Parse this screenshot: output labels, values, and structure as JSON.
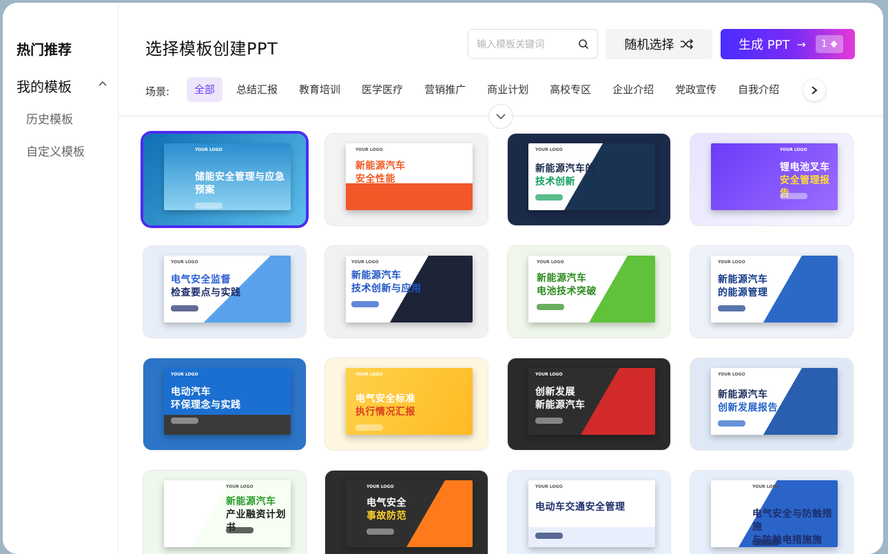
{
  "sidebar": {
    "hot": "热门推荐",
    "my_templates": "我的模板",
    "history": "历史模板",
    "custom": "自定义模板"
  },
  "header": {
    "title": "选择模板创建PPT",
    "search_placeholder": "输入模板关键词",
    "random_label": "随机选择",
    "generate_label": "生成 PPT",
    "generate_count": "1"
  },
  "scene": {
    "label": "场景:",
    "tabs": [
      "全部",
      "总结汇报",
      "教育培训",
      "医学医疗",
      "营销推广",
      "商业计划",
      "高校专区",
      "企业介绍",
      "党政宣传",
      "自我介绍"
    ]
  },
  "templates": [
    {
      "title1": "储能安全管理与应急预案",
      "title2": "",
      "logo": "YOUR LOGO"
    },
    {
      "title1": "新能源汽车",
      "title2": "安全性能",
      "logo": "YOUR LOGO"
    },
    {
      "title1": "新能源汽车的",
      "title2": "技术创新",
      "logo": "YOUR LOGO"
    },
    {
      "title1": "锂电池叉车",
      "title2": "安全管理报告",
      "logo": "YOUR LOGO"
    },
    {
      "title1": "电气安全监督",
      "title2": "检查要点与实践",
      "logo": "YOUR LOGO"
    },
    {
      "title1": "新能源汽车",
      "title2": "技术创新与应用",
      "logo": "YOUR LOGO"
    },
    {
      "title1": "新能源汽车",
      "title2": "电池技术突破",
      "logo": "YOUR LOGO"
    },
    {
      "title1": "新能源汽车",
      "title2": "的能源管理",
      "logo": "YOUR LOGO"
    },
    {
      "title1": "电动汽车",
      "title2": "环保理念与实践",
      "logo": "YOUR LOGO"
    },
    {
      "title1": "电气安全标准",
      "title2": "执行情况汇报",
      "logo": "YOUR LOGO"
    },
    {
      "title1": "创新发展",
      "title2": "新能源汽车",
      "logo": "YOUR LOGO"
    },
    {
      "title1": "新能源汽车",
      "title2": "创新发展报告",
      "logo": "YOUR LOGO"
    },
    {
      "title1": "新能源汽车",
      "title2": "产业融资计划书",
      "logo": "YOUR LOGO"
    },
    {
      "title1": "电气安全",
      "title2": "事故防范",
      "logo": "YOUR LOGO"
    },
    {
      "title1": "电动车交通安全管理",
      "title2": "",
      "logo": "YOUR LOGO"
    },
    {
      "title1": "电气安全与防触措施",
      "title2": "与防触电措施施",
      "logo": "YOUR LOGO"
    }
  ]
}
